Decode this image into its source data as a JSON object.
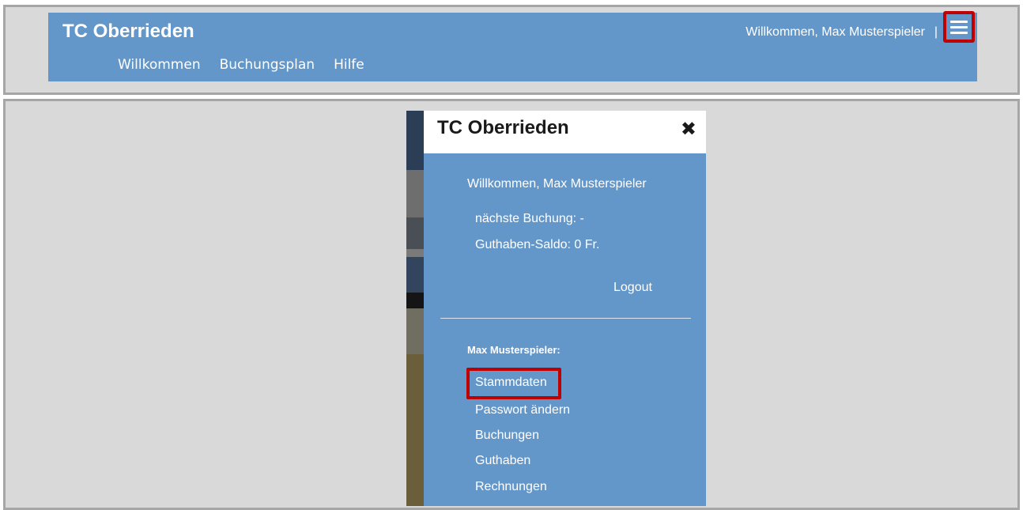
{
  "header": {
    "title": "TC Oberrieden",
    "nav": [
      "Willkommen",
      "Buchungsplan",
      "Hilfe"
    ],
    "welcome": "Willkommen, Max Musterspieler",
    "separator": "|",
    "menu_icon": "hamburger-menu-icon"
  },
  "drawer": {
    "title": "TC Oberrieden",
    "close_icon": "close-icon",
    "close_glyph": "✖",
    "welcome": "Willkommen, Max Musterspieler",
    "next_booking": "nächste Buchung: -",
    "balance": "Guthaben-Saldo: 0 Fr.",
    "logout": "Logout",
    "user_heading": "Max Musterspieler:",
    "menu_items": [
      "Stammdaten",
      "Passwort ändern",
      "Buchungen",
      "Guthaben",
      "Rechnungen"
    ]
  },
  "colors": {
    "header_bg": "#6497c9",
    "frame_bg": "#d9d9d9",
    "highlight": "#c00000"
  }
}
